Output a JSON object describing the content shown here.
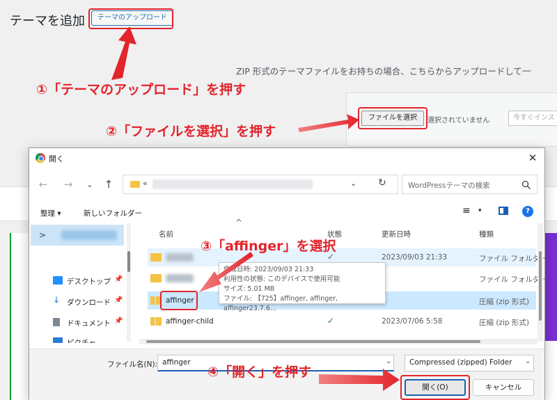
{
  "wp": {
    "title": "テーマを追加",
    "upload_button": "テーマのアップロード",
    "zip_description": "ZIP 形式のテーマファイルをお持ちの場合、こちらからアップロードして一",
    "file_button": "ファイルを選択",
    "no_file": "選択されていません",
    "install_button": "今すぐインス"
  },
  "annotations": {
    "step1": "①「テーマのアップロード」を押す",
    "step2": "②「ファイルを選択」を押す",
    "step3": "③「affinger」を選択",
    "step4": "④「開く」を押す",
    "color": "#e3242b"
  },
  "dialog": {
    "title": "開く",
    "close": "✕",
    "nav": {
      "back": "←",
      "forward": "→",
      "recent": "⌄",
      "up": "↑",
      "address_prefix": "«",
      "address_dropdown": "⌄",
      "refresh": "↻"
    },
    "search_placeholder": "WordPressテーマの検索",
    "toolbar": {
      "organize": "整理 ▾",
      "new_folder": "新しいフォルダー",
      "view": "≡",
      "view_dropdown": "▾",
      "help": "?"
    },
    "sidebar": {
      "expander": ">",
      "items": [
        {
          "label": "デスクトップ",
          "icon": "desktop-icon",
          "pin": "📌"
        },
        {
          "label": "ダウンロード",
          "icon": "download-icon",
          "pin": "📌"
        },
        {
          "label": "ドキュメント",
          "icon": "document-icon",
          "pin": "📌"
        },
        {
          "label": "ピクチャ",
          "icon": "picture-icon",
          "pin": ""
        }
      ]
    },
    "columns": {
      "sort_indicator": "^",
      "name": "名前",
      "status": "状態",
      "modified": "更新日時",
      "type": "種類"
    },
    "files": [
      {
        "name": "",
        "status": "✓",
        "modified": "2023/09/03 21:33",
        "type": "ファイル フォルダー"
      },
      {
        "name": "",
        "status": "✓",
        "modified": "",
        "type": "ファイル フォルダー"
      },
      {
        "name": "affinger",
        "status": "✓",
        "modified": "",
        "type": "圧縮 (zip 形式)"
      },
      {
        "name": "affinger-child",
        "status": "✓",
        "modified": "2023/07/06 5:58",
        "type": "圧縮 (zip 形式)"
      }
    ],
    "tooltip": {
      "created": "作成日時: 2023/09/03 21:33",
      "availability": "利用性の状態: このデバイスで使用可能",
      "size": "サイズ: 5.01 MB",
      "files": "ファイル: 【725】affinger, affinger, affinger23.7.6..."
    },
    "footer": {
      "filename_label": "ファイル名(N):",
      "filename_value": "affinger",
      "filename_dropdown": "⌄",
      "filetype": "Compressed (zipped) Folder",
      "filetype_dropdown": "⌄",
      "open_button": "開く(O)",
      "cancel_button": "キャンセル"
    }
  }
}
